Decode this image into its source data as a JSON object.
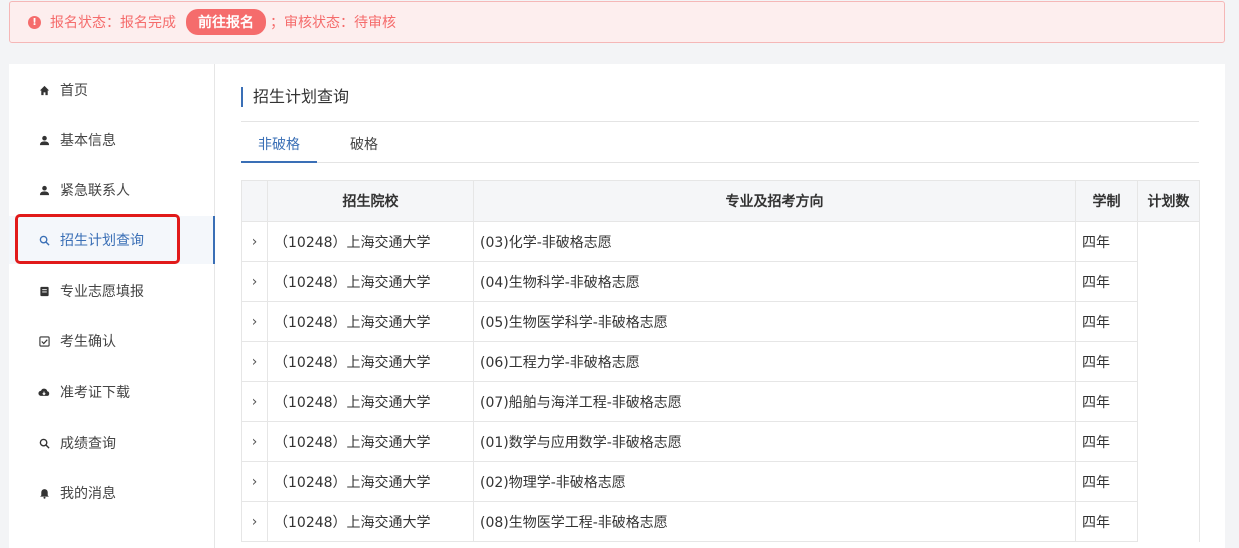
{
  "alert": {
    "status_text": "报名状态：报名完成",
    "button_label": "前往报名",
    "review_text": "；审核状态：待审核"
  },
  "sidebar": {
    "items": [
      {
        "label": "首页",
        "icon": "home-icon"
      },
      {
        "label": "基本信息",
        "icon": "user-icon"
      },
      {
        "label": "紧急联系人",
        "icon": "user-icon"
      },
      {
        "label": "招生计划查询",
        "icon": "search-icon"
      },
      {
        "label": "专业志愿填报",
        "icon": "form-icon"
      },
      {
        "label": "考生确认",
        "icon": "check-icon"
      },
      {
        "label": "准考证下载",
        "icon": "cloud-download-icon"
      },
      {
        "label": "成绩查询",
        "icon": "search-icon"
      },
      {
        "label": "我的消息",
        "icon": "bell-icon"
      }
    ],
    "active_index": 3
  },
  "main": {
    "title": "招生计划查询",
    "tabs": [
      "非破格",
      "破格"
    ],
    "active_tab": 0,
    "table": {
      "headers": [
        "招生院校",
        "专业及招考方向",
        "学制",
        "计划数"
      ],
      "rows": [
        {
          "school": "（10248）上海交通大学",
          "major": "(03)化学-非破格志愿",
          "years": "四年",
          "plan": ""
        },
        {
          "school": "（10248）上海交通大学",
          "major": "(04)生物科学-非破格志愿",
          "years": "四年",
          "plan": ""
        },
        {
          "school": "（10248）上海交通大学",
          "major": "(05)生物医学科学-非破格志愿",
          "years": "四年",
          "plan": ""
        },
        {
          "school": "（10248）上海交通大学",
          "major": "(06)工程力学-非破格志愿",
          "years": "四年",
          "plan": ""
        },
        {
          "school": "（10248）上海交通大学",
          "major": "(07)船舶与海洋工程-非破格志愿",
          "years": "四年",
          "plan": ""
        },
        {
          "school": "（10248）上海交通大学",
          "major": "(01)数学与应用数学-非破格志愿",
          "years": "四年",
          "plan": ""
        },
        {
          "school": "（10248）上海交通大学",
          "major": "(02)物理学-非破格志愿",
          "years": "四年",
          "plan": ""
        },
        {
          "school": "（10248）上海交通大学",
          "major": "(08)生物医学工程-非破格志愿",
          "years": "四年",
          "plan": ""
        }
      ]
    }
  },
  "colors": {
    "accent": "#3a6fb6",
    "alert_text": "#f56c6c",
    "alert_bg": "#fdeeee",
    "highlight": "#e11a1a"
  }
}
